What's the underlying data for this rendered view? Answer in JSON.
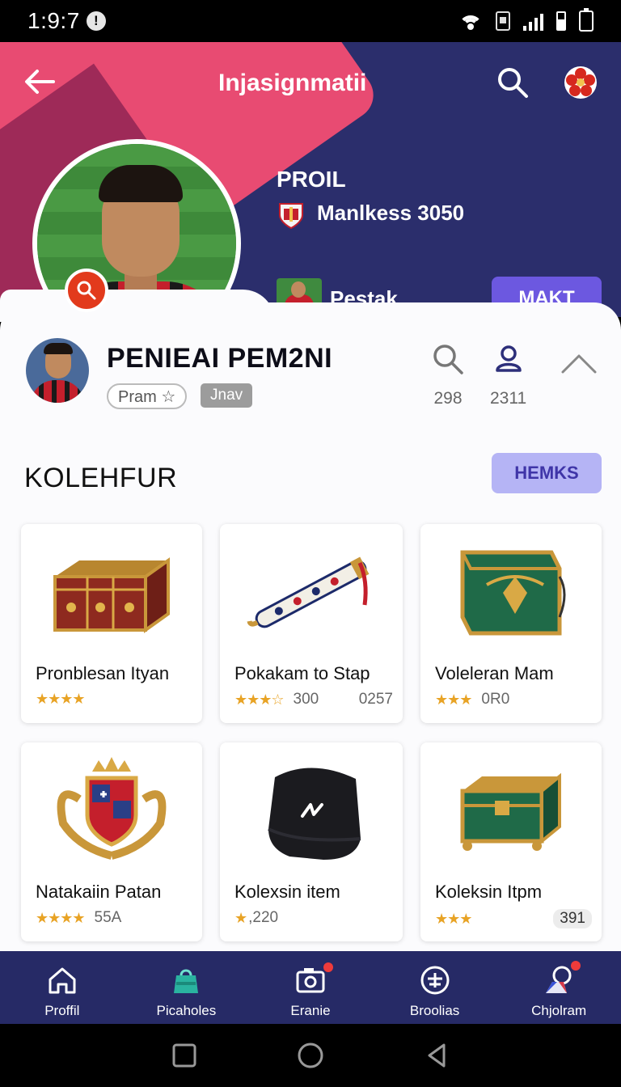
{
  "status_bar": {
    "time": "1:9:7",
    "alert_glyph": "!"
  },
  "header": {
    "title": "Injasignmatii",
    "profile_label": "PROIL",
    "club": "Manlkess 3050",
    "player_name": "Pestak",
    "action_button": "MAKT"
  },
  "profile": {
    "name": "PENIEAI PEM2NI",
    "tag_primary": "Pram ☆",
    "tag_secondary": "Jnav",
    "stats": [
      {
        "icon": "search-icon",
        "value": "298"
      },
      {
        "icon": "people-icon",
        "value": "2311"
      }
    ]
  },
  "collection": {
    "title": "KOLEHFUR",
    "button": "HEMKS",
    "items": [
      {
        "name": "Pronblesan Ityan",
        "stars": "★★★★",
        "meta_left": "",
        "meta_right": "",
        "image": "red-gold-chest"
      },
      {
        "name": "Pokakam to Stap",
        "stars": "★★★☆",
        "meta_left": "300",
        "meta_right": "0257",
        "image": "ornate-flute"
      },
      {
        "name": "Voleleran Mam",
        "stars": "★★★",
        "meta_left": "0R0",
        "meta_right": "",
        "image": "green-gold-chest"
      },
      {
        "name": "Natakaiin Patan",
        "stars": "★★★★",
        "meta_left": "55A",
        "meta_right": "",
        "image": "royal-crest"
      },
      {
        "name": "Kolexsin item",
        "stars": "★",
        "meta_left": ",220",
        "meta_right": "",
        "image": "black-bag"
      },
      {
        "name": "Koleksin Itpm",
        "stars": "★★★",
        "meta_left": "",
        "meta_right": "391",
        "image": "green-treasure-chest"
      }
    ]
  },
  "bottom_nav": [
    {
      "label": "Proffil",
      "icon": "home-icon"
    },
    {
      "label": "Picaholes",
      "icon": "bag-icon"
    },
    {
      "label": "Eranie",
      "icon": "camera-icon"
    },
    {
      "label": "Broolias",
      "icon": "plus-circle-icon"
    },
    {
      "label": "Chjolram",
      "icon": "chat-icon"
    }
  ],
  "colors": {
    "header_bg": "#2b2e6c",
    "accent_pink": "#e84b72",
    "primary_button": "#6c58e0",
    "secondary_button": "#b5b4f5",
    "nav_bg": "#262a66",
    "star": "#e8a325"
  }
}
